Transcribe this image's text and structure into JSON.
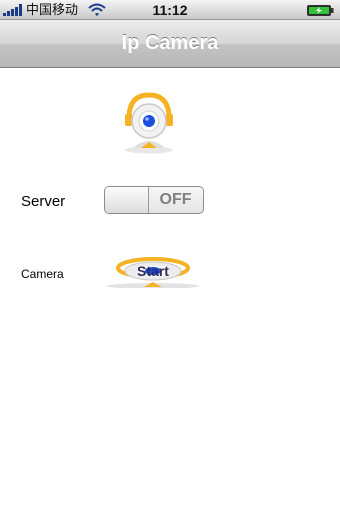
{
  "status_bar": {
    "carrier": "中国移动",
    "time": "11:12",
    "icons": [
      "signal-bars-icon",
      "wifi-icon",
      "battery-charging-icon"
    ]
  },
  "nav": {
    "title": "Ip Camera"
  },
  "server": {
    "label": "Server",
    "switch_state": "OFF"
  },
  "camera": {
    "label": "Camera",
    "start_label": "Start"
  },
  "colors": {
    "accent_orange": "#f5b324",
    "lens_blue": "#1a4fe0",
    "title_text": "#ffffff"
  }
}
